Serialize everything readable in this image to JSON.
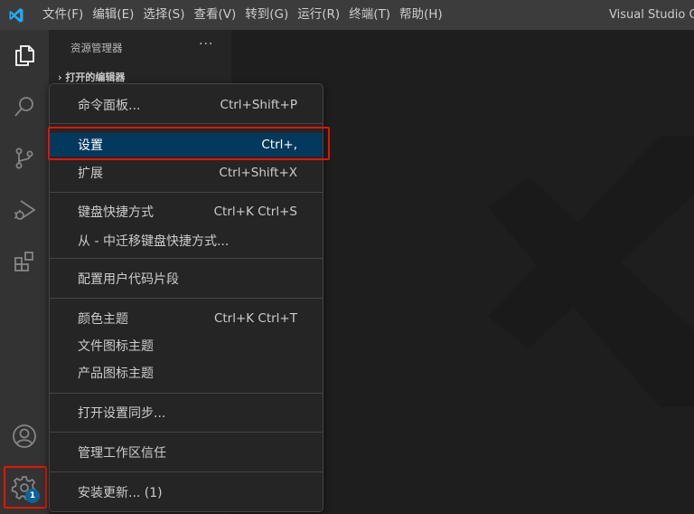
{
  "menubar": {
    "items": [
      "文件(F)",
      "编辑(E)",
      "选择(S)",
      "查看(V)",
      "转到(G)",
      "运行(R)",
      "终端(T)",
      "帮助(H)"
    ],
    "app_title": "Visual Studio Co"
  },
  "activitybar": {
    "icons": [
      "explorer-icon",
      "search-icon",
      "source-control-icon",
      "run-debug-icon",
      "extensions-icon",
      "account-icon",
      "manage-gear-icon"
    ],
    "gear_badge": "1"
  },
  "sidebar": {
    "title": "资源管理器",
    "more": "···",
    "section": "› 打开的编辑器"
  },
  "context_menu": {
    "items": [
      {
        "label": "命令面板...",
        "shortcut": "Ctrl+Shift+P"
      },
      {
        "label": "设置",
        "shortcut": "Ctrl+,"
      },
      {
        "label": "扩展",
        "shortcut": "Ctrl+Shift+X"
      },
      {
        "label": "键盘快捷方式",
        "shortcut": "Ctrl+K Ctrl+S"
      },
      {
        "label": "从 - 中迁移键盘快捷方式...",
        "shortcut": ""
      },
      {
        "label": "配置用户代码片段",
        "shortcut": ""
      },
      {
        "label": "颜色主题",
        "shortcut": "Ctrl+K Ctrl+T"
      },
      {
        "label": "文件图标主题",
        "shortcut": ""
      },
      {
        "label": "产品图标主题",
        "shortcut": ""
      },
      {
        "label": "打开设置同步...",
        "shortcut": ""
      },
      {
        "label": "管理工作区信任",
        "shortcut": ""
      },
      {
        "label": "安装更新... (1)",
        "shortcut": ""
      }
    ],
    "selected_index": 1
  },
  "colors": {
    "highlight_border": "#e51400",
    "selection": "#04395e",
    "badge": "#0e639c",
    "logo": "#23a9f2"
  }
}
